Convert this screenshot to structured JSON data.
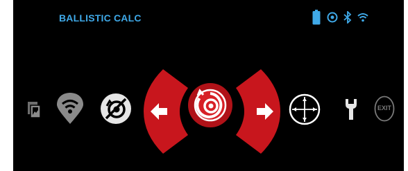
{
  "header": {
    "title": "BALLISTIC CALC"
  },
  "status_icons": [
    "battery-icon",
    "gps-target-icon",
    "bluetooth-icon",
    "wifi-icon"
  ],
  "menu": {
    "items": [
      {
        "name": "gallery-icon",
        "selected": false
      },
      {
        "name": "wifi-shield-icon",
        "selected": false
      },
      {
        "name": "no-target-icon",
        "selected": false
      },
      {
        "name": "scroll-left-arrow",
        "selected": false
      },
      {
        "name": "ballistic-calc-icon",
        "selected": true
      },
      {
        "name": "scroll-right-arrow",
        "selected": false
      },
      {
        "name": "crosshair-icon",
        "selected": false
      },
      {
        "name": "wrench-icon",
        "selected": false
      },
      {
        "name": "exit-icon",
        "selected": false
      }
    ],
    "exit_label": "EXIT"
  },
  "colors": {
    "accent_blue": "#3fa9e8",
    "selected_red": "#c8161d",
    "icon_white": "#ffffff",
    "icon_gray": "#7a7a7a"
  }
}
